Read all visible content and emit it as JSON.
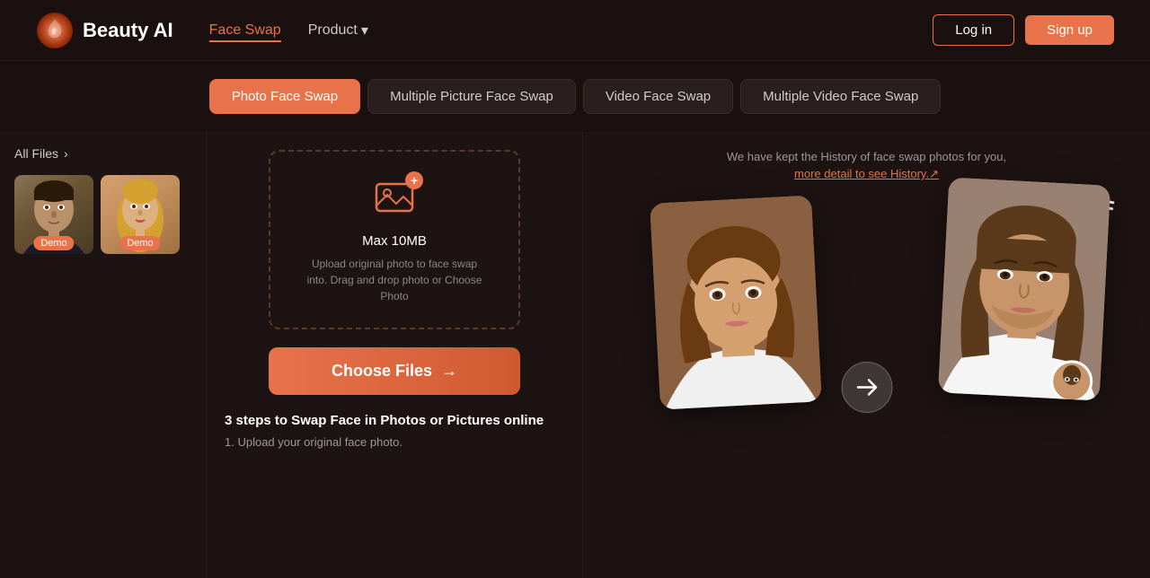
{
  "app": {
    "name": "Beauty AI",
    "logo_alt": "beauty-ai-logo"
  },
  "header": {
    "nav_faceswap": "Face Swap",
    "nav_product": "Product",
    "nav_product_arrow": "▾",
    "btn_login": "Log in",
    "btn_signup": "Sign up"
  },
  "tabs": [
    {
      "id": "photo",
      "label": "Photo Face Swap",
      "active": true
    },
    {
      "id": "multiple",
      "label": "Multiple Picture Face Swap",
      "active": false
    },
    {
      "id": "video",
      "label": "Video Face Swap",
      "active": false
    },
    {
      "id": "multiple-video",
      "label": "Multiple Video Face Swap",
      "active": false
    }
  ],
  "file_panel": {
    "all_files": "All Files",
    "chevron": "›",
    "demo1_badge": "Demo",
    "demo2_badge": "Demo"
  },
  "upload": {
    "max_size": "Max 10MB",
    "description": "Upload original photo to face swap into. Drag and drop photo or Choose Photo",
    "choose_btn": "Choose Files",
    "choose_arrow": "→"
  },
  "steps": {
    "title": "3 steps to Swap Face in Photos or Pictures online",
    "step1": "1. Upload your original face photo."
  },
  "history": {
    "text": "We have kept the History of face swap photos for you,",
    "link": "more detail to see History.↗"
  }
}
